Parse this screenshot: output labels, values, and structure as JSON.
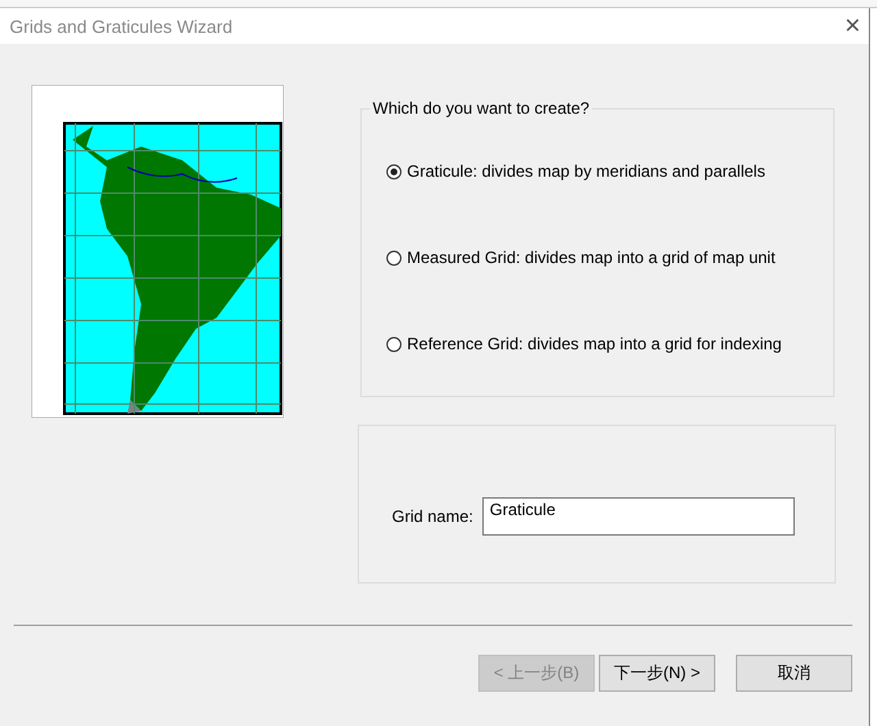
{
  "window": {
    "title": "Grids and Graticules Wizard",
    "close": "×"
  },
  "choice": {
    "legend": "Which do you want to create?",
    "options": [
      {
        "label": "Graticule: divides map by meridians and parallels",
        "selected": true
      },
      {
        "label": "Measured Grid: divides map into a grid of map unit",
        "selected": false
      },
      {
        "label": "Reference Grid: divides map into a grid for indexing",
        "selected": false
      }
    ]
  },
  "grid_name": {
    "label": "Grid name:",
    "value": "Graticule"
  },
  "buttons": [
    {
      "label": "< 上一步(B)",
      "disabled": true
    },
    {
      "label": "下一步(N) >",
      "disabled": false
    },
    {
      "label": "取消",
      "disabled": false
    }
  ]
}
